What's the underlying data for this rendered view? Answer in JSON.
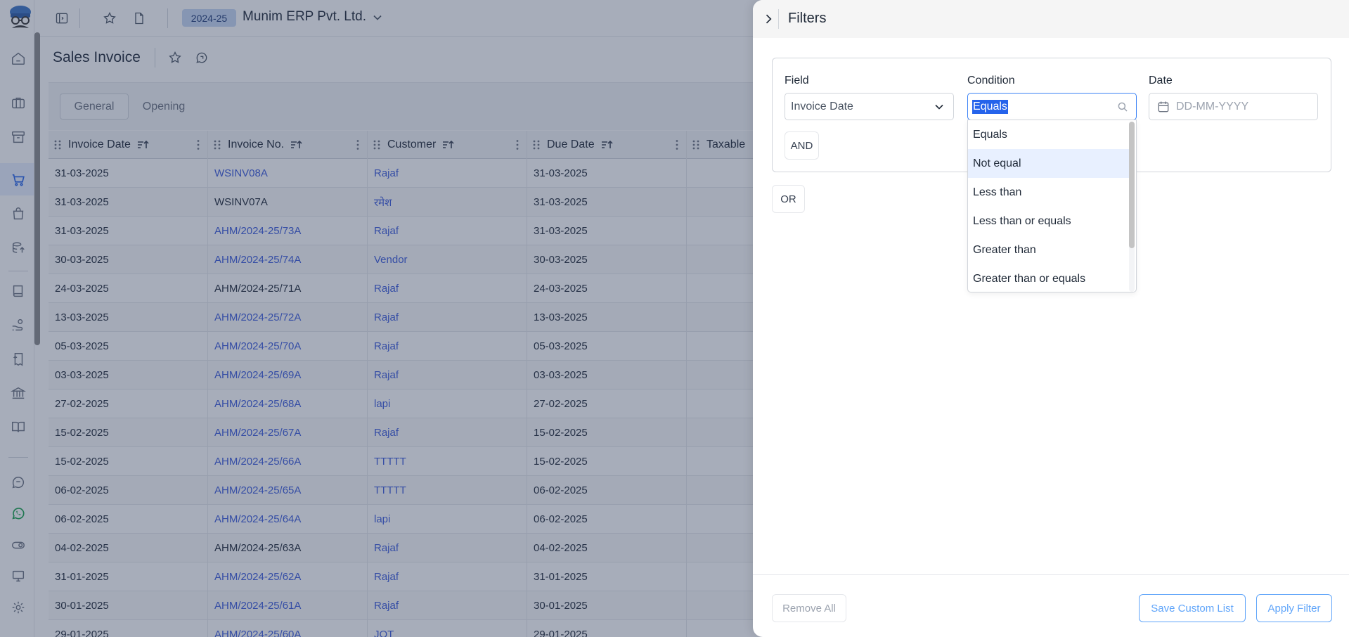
{
  "app": {
    "fiscal_year": "2024-25",
    "company": "Munim ERP Pvt. Ltd."
  },
  "page": {
    "title": "Sales Invoice"
  },
  "tabs": [
    {
      "label": "General",
      "active": true
    },
    {
      "label": "Opening",
      "active": false
    }
  ],
  "table": {
    "columns": [
      "Invoice Date",
      "Invoice No.",
      "Customer",
      "Due Date",
      "Taxable"
    ],
    "rows": [
      {
        "date": "31-03-2025",
        "no": "WSINV08A",
        "no_link": true,
        "customer": "Rajaf",
        "due": "31-03-2025"
      },
      {
        "date": "31-03-2025",
        "no": "WSINV07A",
        "no_link": false,
        "customer": "रमेश",
        "due": "31-03-2025"
      },
      {
        "date": "31-03-2025",
        "no": "AHM/2024-25/73A",
        "no_link": true,
        "customer": "Rajaf",
        "due": "31-03-2025"
      },
      {
        "date": "30-03-2025",
        "no": "AHM/2024-25/74A",
        "no_link": true,
        "customer": "Vendor",
        "due": "30-03-2025"
      },
      {
        "date": "24-03-2025",
        "no": "AHM/2024-25/71A",
        "no_link": false,
        "customer": "Rajaf",
        "due": "24-03-2025"
      },
      {
        "date": "13-03-2025",
        "no": "AHM/2024-25/72A",
        "no_link": true,
        "customer": "Rajaf",
        "due": "13-03-2025"
      },
      {
        "date": "05-03-2025",
        "no": "AHM/2024-25/70A",
        "no_link": true,
        "customer": "Rajaf",
        "due": "05-03-2025"
      },
      {
        "date": "03-03-2025",
        "no": "AHM/2024-25/69A",
        "no_link": true,
        "customer": "Rajaf",
        "due": "03-03-2025"
      },
      {
        "date": "27-02-2025",
        "no": "AHM/2024-25/68A",
        "no_link": true,
        "customer": "lapi",
        "due": "27-02-2025"
      },
      {
        "date": "15-02-2025",
        "no": "AHM/2024-25/67A",
        "no_link": true,
        "customer": "Rajaf",
        "due": "15-02-2025"
      },
      {
        "date": "15-02-2025",
        "no": "AHM/2024-25/66A",
        "no_link": true,
        "customer": "TTTTT",
        "due": "15-02-2025"
      },
      {
        "date": "06-02-2025",
        "no": "AHM/2024-25/65A",
        "no_link": true,
        "customer": "TTTTT",
        "due": "06-02-2025"
      },
      {
        "date": "06-02-2025",
        "no": "AHM/2024-25/64A",
        "no_link": true,
        "customer": "lapi",
        "due": "06-02-2025"
      },
      {
        "date": "04-02-2025",
        "no": "AHM/2024-25/63A",
        "no_link": false,
        "customer": "Rajaf",
        "due": "04-02-2025"
      },
      {
        "date": "31-01-2025",
        "no": "AHM/2024-25/62A",
        "no_link": true,
        "customer": "Rajaf",
        "due": "31-01-2025"
      },
      {
        "date": "30-01-2025",
        "no": "AHM/2024-25/61A",
        "no_link": true,
        "customer": "Rajaf",
        "due": "30-01-2025"
      },
      {
        "date": "29-01-2025",
        "no": "AHM/2024-25/60A",
        "no_link": true,
        "customer": "JOT",
        "due": "29-01-2025"
      }
    ]
  },
  "filters": {
    "title": "Filters",
    "field_label": "Field",
    "field_value": "Invoice Date",
    "condition_label": "Condition",
    "condition_value": "Equals",
    "date_label": "Date",
    "date_placeholder": "DD-MM-YYYY",
    "and_label": "AND",
    "or_label": "OR",
    "condition_options": [
      "Equals",
      "Not equal",
      "Less than",
      "Less than or equals",
      "Greater than",
      "Greater than or equals"
    ],
    "highlighted_option": "Not equal",
    "remove_all_label": "Remove All",
    "save_custom_list_label": "Save Custom List",
    "apply_filter_label": "Apply Filter"
  },
  "colors": {
    "accent": "#3b82f6",
    "link": "#3b5bdb",
    "badge_bg": "#c7d7f3"
  }
}
